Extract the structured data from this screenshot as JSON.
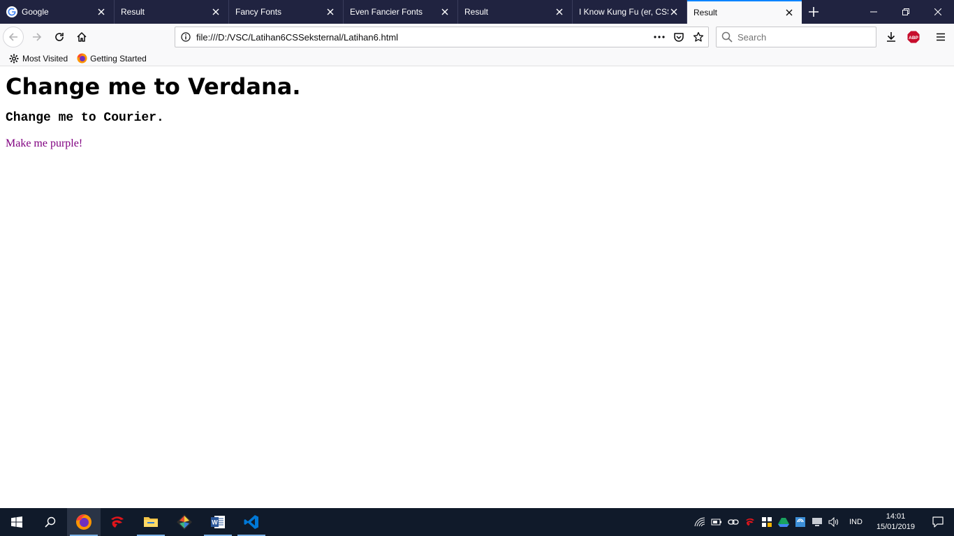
{
  "tabs": [
    {
      "title": "Google",
      "favicon": "google-icon",
      "active": false
    },
    {
      "title": "Result",
      "favicon": "",
      "active": false
    },
    {
      "title": "Fancy Fonts",
      "favicon": "",
      "active": false
    },
    {
      "title": "Even Fancier Fonts",
      "favicon": "",
      "active": false
    },
    {
      "title": "Result",
      "favicon": "",
      "active": false
    },
    {
      "title": "I Know Kung Fu (er, CSS)",
      "favicon": "",
      "active": false
    },
    {
      "title": "Result",
      "favicon": "",
      "active": true
    }
  ],
  "urlbar": {
    "url": "file:///D:/VSC/Latihan6CSSeksternal/Latihan6.html"
  },
  "search": {
    "placeholder": "Search"
  },
  "bookmarks": [
    {
      "label": "Most Visited",
      "icon": "gear-icon"
    },
    {
      "label": "Getting Started",
      "icon": "firefox-icon"
    }
  ],
  "page": {
    "heading": "Change me to Verdana.",
    "subheading": "Change me to Courier.",
    "paragraph": "Make me purple!",
    "paragraph_color": "#800080"
  },
  "taskbar": {
    "apps": [
      "windows-start-icon",
      "search-icon",
      "firefox-icon",
      "garena-icon",
      "file-explorer-icon",
      "git-icon",
      "word-icon",
      "vscode-icon"
    ],
    "language": "IND",
    "time": "14:01",
    "date": "15/01/2019"
  },
  "colors": {
    "tabstrip": "#202340",
    "active_tab_accent": "#0a84ff",
    "toolbar": "#f9f9fa",
    "taskbar": "#101a2a"
  }
}
